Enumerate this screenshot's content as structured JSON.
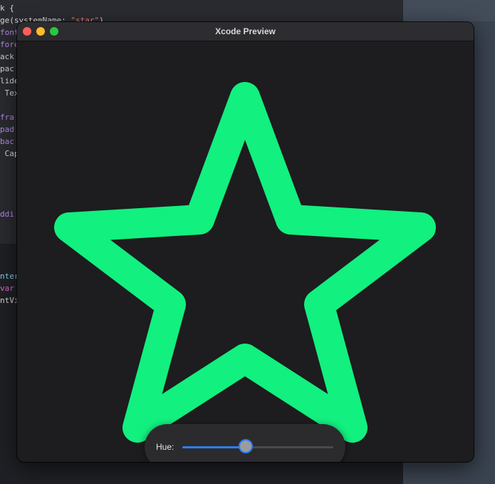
{
  "editor": {
    "lines": [
      {
        "parts": [
          {
            "t": "k {",
            "c": ""
          }
        ]
      },
      {
        "parts": [
          {
            "t": "ge(systemName: ",
            "c": ""
          },
          {
            "t": "\"star\"",
            "c": "str"
          },
          {
            "t": ")",
            "c": ""
          }
        ]
      },
      {
        "parts": [
          {
            "t": "font",
            "c": "kw2"
          }
        ]
      },
      {
        "parts": [
          {
            "t": "fore",
            "c": "kw2"
          }
        ]
      },
      {
        "parts": [
          {
            "t": "ack",
            "c": ""
          }
        ]
      },
      {
        "parts": [
          {
            "t": "pac",
            "c": ""
          }
        ]
      },
      {
        "parts": [
          {
            "t": "lide",
            "c": ""
          }
        ]
      },
      {
        "parts": [
          {
            "t": " Tex",
            "c": ""
          }
        ]
      },
      {
        "parts": [
          {
            "t": "",
            "c": ""
          }
        ]
      },
      {
        "parts": [
          {
            "t": "fra",
            "c": "kw2"
          }
        ]
      },
      {
        "parts": [
          {
            "t": "pad",
            "c": "kw2"
          }
        ]
      },
      {
        "parts": [
          {
            "t": "bac",
            "c": "kw2"
          }
        ]
      },
      {
        "parts": [
          {
            "t": " Cap",
            "c": ""
          }
        ]
      },
      {
        "parts": [
          {
            "t": "",
            "c": ""
          }
        ]
      },
      {
        "parts": [
          {
            "t": "",
            "c": ""
          }
        ]
      },
      {
        "parts": [
          {
            "t": "",
            "c": ""
          }
        ]
      },
      {
        "parts": [
          {
            "t": "",
            "c": ""
          }
        ]
      },
      {
        "parts": [
          {
            "t": "ddi",
            "c": "kw2"
          }
        ]
      }
    ],
    "lower_lines": [
      {
        "parts": [
          {
            "t": "nter",
            "c": "teal"
          }
        ]
      },
      {
        "parts": [
          {
            "t": "var",
            "c": "kw"
          }
        ]
      },
      {
        "parts": [
          {
            "t": "ntVi",
            "c": ""
          }
        ]
      }
    ]
  },
  "window": {
    "title": "Xcode Preview"
  },
  "preview": {
    "shape_icon": "star-icon",
    "star_color": "#12f07f",
    "background": "#1d1c1f"
  },
  "hue_control": {
    "label": "Hue:",
    "value": 0.42,
    "accent": "#2e7ef0"
  }
}
